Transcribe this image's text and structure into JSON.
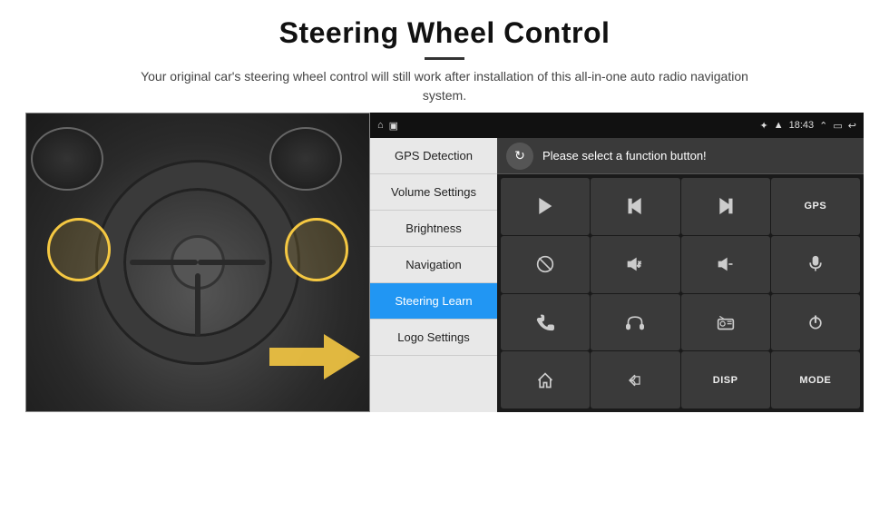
{
  "page": {
    "title": "Steering Wheel Control",
    "subtitle": "Your original car's steering wheel control will still work after installation of this all-in-one auto radio navigation system."
  },
  "status_bar": {
    "time": "18:43",
    "icons_left": [
      "home",
      "media"
    ],
    "icons_right": [
      "bluetooth",
      "signal",
      "arrow-up",
      "battery",
      "back"
    ]
  },
  "menu": {
    "items": [
      {
        "id": "gps",
        "label": "GPS Detection",
        "active": false
      },
      {
        "id": "volume",
        "label": "Volume Settings",
        "active": false
      },
      {
        "id": "brightness",
        "label": "Brightness",
        "active": false
      },
      {
        "id": "navigation",
        "label": "Navigation",
        "active": false
      },
      {
        "id": "steering",
        "label": "Steering Learn",
        "active": true
      },
      {
        "id": "logo",
        "label": "Logo Settings",
        "active": false
      }
    ]
  },
  "content": {
    "header_text": "Please select a function button!",
    "refresh_icon": "↻",
    "buttons": [
      {
        "id": "play",
        "icon": "play",
        "label": ""
      },
      {
        "id": "prev",
        "icon": "prev",
        "label": ""
      },
      {
        "id": "next",
        "icon": "next",
        "label": ""
      },
      {
        "id": "gps",
        "icon": "text",
        "label": "GPS"
      },
      {
        "id": "mute",
        "icon": "mute",
        "label": ""
      },
      {
        "id": "vol-up",
        "icon": "vol-up",
        "label": ""
      },
      {
        "id": "vol-down",
        "icon": "vol-down",
        "label": ""
      },
      {
        "id": "mic",
        "icon": "mic",
        "label": ""
      },
      {
        "id": "phone",
        "icon": "phone",
        "label": ""
      },
      {
        "id": "headset",
        "icon": "headset",
        "label": ""
      },
      {
        "id": "radio",
        "icon": "radio",
        "label": ""
      },
      {
        "id": "power",
        "icon": "power",
        "label": ""
      },
      {
        "id": "home",
        "icon": "home",
        "label": ""
      },
      {
        "id": "back",
        "icon": "back",
        "label": ""
      },
      {
        "id": "disp",
        "icon": "text",
        "label": "DISP"
      },
      {
        "id": "mode",
        "icon": "text",
        "label": "MODE"
      }
    ]
  }
}
